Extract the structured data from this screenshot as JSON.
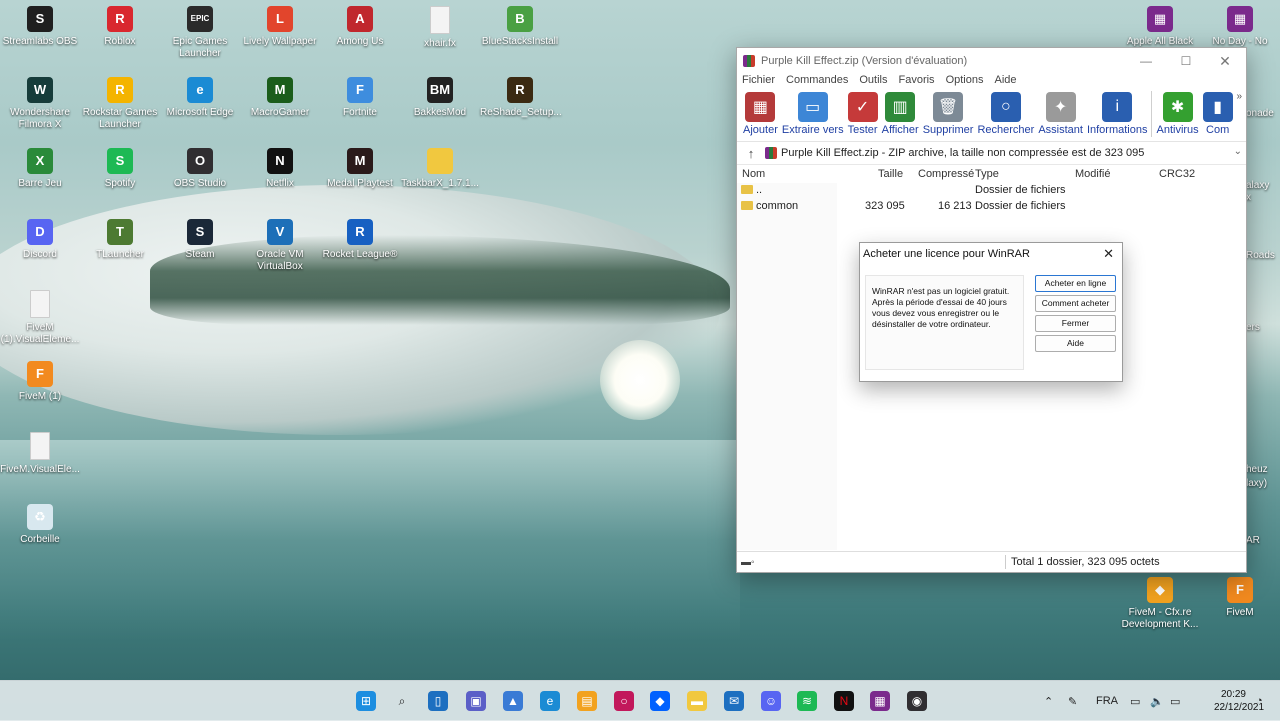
{
  "desktop": {
    "icons_left": [
      {
        "label": "Streamlabs OBS",
        "icon": "streamlabs-icon",
        "color": "#1f1f1f",
        "glyph": "S"
      },
      {
        "label": "Roblox",
        "icon": "roblox-icon",
        "color": "#d9272e",
        "glyph": "R"
      },
      {
        "label": "Epic Games Launcher",
        "icon": "epic-games-icon",
        "color": "#2a2a2a",
        "glyph": "EPIC"
      },
      {
        "label": "Lively Wallpaper",
        "icon": "lively-wallpaper-icon",
        "color": "#e2452c",
        "glyph": "L"
      },
      {
        "label": "Among Us",
        "icon": "among-us-icon",
        "color": "#c0272d",
        "glyph": "A"
      },
      {
        "label": "xhair.fx",
        "icon": "file-icon",
        "color": "#f4f4f4",
        "glyph": ""
      },
      {
        "label": "BlueStacksInstall",
        "icon": "bluestacks-icon",
        "color": "#4aa043",
        "glyph": "B"
      },
      {
        "label": "Wondershare Filmora X",
        "icon": "filmora-icon",
        "color": "#163c3a",
        "glyph": "W"
      },
      {
        "label": "Rockstar Games Launcher",
        "icon": "rockstar-icon",
        "color": "#f4b400",
        "glyph": "R"
      },
      {
        "label": "Microsoft Edge",
        "icon": "edge-icon",
        "color": "#1b8bd4",
        "glyph": "e"
      },
      {
        "label": "MacroGamer",
        "icon": "macrogamer-icon",
        "color": "#1b5d1b",
        "glyph": "M"
      },
      {
        "label": "Fortnite",
        "icon": "fortnite-icon",
        "color": "#3e8dde",
        "glyph": "F"
      },
      {
        "label": "BakkesMod",
        "icon": "bakkesmod-icon",
        "color": "#222",
        "glyph": "BM"
      },
      {
        "label": "ReShade_Setup...",
        "icon": "reshade-icon",
        "color": "#3b2a12",
        "glyph": "R"
      },
      {
        "label": "Barre Jeu",
        "icon": "game-bar-icon",
        "color": "#2a8a3a",
        "glyph": "X"
      },
      {
        "label": "Spotify",
        "icon": "spotify-icon",
        "color": "#1db954",
        "glyph": "S"
      },
      {
        "label": "OBS Studio",
        "icon": "obs-icon",
        "color": "#302e31",
        "glyph": "O"
      },
      {
        "label": "Netflix",
        "icon": "netflix-icon",
        "color": "#111",
        "glyph": "N"
      },
      {
        "label": "Medal Playtest",
        "icon": "medal-icon",
        "color": "#2a1a1a",
        "glyph": "M"
      },
      {
        "label": "TaskbarX_1.7.1...",
        "icon": "folder-icon",
        "color": "#f1c83f",
        "glyph": ""
      },
      {
        "label": "Discord",
        "icon": "discord-icon",
        "color": "#5865f2",
        "glyph": "D"
      },
      {
        "label": "TLauncher",
        "icon": "tlauncher-icon",
        "color": "#4d7a32",
        "glyph": "T"
      },
      {
        "label": "Steam",
        "icon": "steam-icon",
        "color": "#1b2838",
        "glyph": "S"
      },
      {
        "label": "Oracle VM VirtualBox",
        "icon": "virtualbox-icon",
        "color": "#1d6fb8",
        "glyph": "V"
      },
      {
        "label": "Rocket League®",
        "icon": "rocket-league-icon",
        "color": "#1760c2",
        "glyph": "R"
      },
      {
        "label": "FiveM (1).VisualEleme...",
        "icon": "file-icon",
        "color": "#f4f4f4",
        "glyph": ""
      },
      {
        "label": "FiveM (1)",
        "icon": "fivem-icon",
        "color": "#f28a1f",
        "glyph": "F"
      },
      {
        "label": "FiveM.VisualEle...",
        "icon": "file-icon",
        "color": "#f4f4f4",
        "glyph": ""
      },
      {
        "label": "Corbeille",
        "icon": "recycle-bin-icon",
        "color": "#d8e8ef",
        "glyph": "♻"
      }
    ],
    "icons_right": [
      {
        "label": "Apple All Black",
        "icon": "winrar-archive-icon",
        "color": "#7b2a8c",
        "glyph": "▦"
      },
      {
        "label": "No Day - No",
        "icon": "winrar-archive-icon",
        "color": "#7b2a8c",
        "glyph": "▦"
      },
      {
        "label": "FiveM - Cfx.re Development K...",
        "icon": "fivem-devkit-icon",
        "color": "#f2a21f",
        "glyph": "◆"
      },
      {
        "label": "FiveM",
        "icon": "fivem-icon",
        "color": "#f28a1f",
        "glyph": "F"
      }
    ],
    "right_edge_fragments": [
      "onade",
      "alaxy",
      "x",
      "Roads",
      "ers",
      "heuz",
      "laxy)",
      "AR"
    ]
  },
  "winrar": {
    "title": "Purple Kill Effect.zip (Version d'évaluation)",
    "menu": [
      "Fichier",
      "Commandes",
      "Outils",
      "Favoris",
      "Options",
      "Aide"
    ],
    "toolbar": [
      {
        "label": "Ajouter",
        "icon": "add-archive-icon",
        "color": "#b43a3a"
      },
      {
        "label": "Extraire vers",
        "icon": "extract-folder-icon",
        "color": "#3d86d6"
      },
      {
        "label": "Tester",
        "icon": "test-clipboard-icon",
        "color": "#c53a3a"
      },
      {
        "label": "Afficher",
        "icon": "view-book-icon",
        "color": "#2f8a3a"
      },
      {
        "label": "Supprimer",
        "icon": "delete-trash-icon",
        "color": "#7d8a96"
      },
      {
        "label": "Rechercher",
        "icon": "find-magnifier-icon",
        "color": "#2a5fb0"
      },
      {
        "label": "Assistant",
        "icon": "wizard-wand-icon",
        "color": "#9a9a9a"
      },
      {
        "label": "Informations",
        "icon": "info-icon",
        "color": "#2a5fb0"
      },
      {
        "label": "Antivirus",
        "icon": "antivirus-bug-icon",
        "color": "#34a030"
      },
      {
        "label": "Com",
        "icon": "comment-icon",
        "color": "#2a5fb0"
      }
    ],
    "path_text": "Purple Kill Effect.zip - ZIP archive, la taille non compressée est de 323 095",
    "columns": {
      "name": "Nom",
      "size": "Taille",
      "packed": "Compressé",
      "type": "Type",
      "modified": "Modifié",
      "crc": "CRC32"
    },
    "rows": [
      {
        "name": "..",
        "size": "",
        "packed": "",
        "type": "Dossier de fichiers"
      },
      {
        "name": "common",
        "size": "323 095",
        "packed": "16 213",
        "type": "Dossier de fichiers"
      }
    ],
    "status": "Total 1 dossier, 323 095 octets"
  },
  "dialog": {
    "title": "Acheter une licence pour WinRAR",
    "message": "WinRAR n'est pas un logiciel gratuit.\nAprès la période d'essai de 40 jours\nvous devez vous enregistrer ou le\ndésinstaller de votre ordinateur.",
    "buttons": [
      "Acheter en ligne",
      "Comment acheter",
      "Fermer",
      "Aide"
    ]
  },
  "taskbar": {
    "apps": [
      {
        "icon": "windows-start-icon",
        "color": "#1d8ee0"
      },
      {
        "icon": "search-icon",
        "color": "#333"
      },
      {
        "icon": "task-view-icon",
        "color": "#1d6fc0"
      },
      {
        "icon": "teams-chat-icon",
        "color": "#5b5fc7"
      },
      {
        "icon": "photos-icon",
        "color": "#3a7bd5"
      },
      {
        "icon": "edge-icon",
        "color": "#1b8bd4"
      },
      {
        "icon": "store-icon",
        "color": "#f2a21f"
      },
      {
        "icon": "medal-ring-icon",
        "color": "#c2185b"
      },
      {
        "icon": "dropbox-icon",
        "color": "#0061fe"
      },
      {
        "icon": "file-explorer-icon",
        "color": "#f1c83f"
      },
      {
        "icon": "mail-icon",
        "color": "#1d6fc0"
      },
      {
        "icon": "discord-icon",
        "color": "#5865f2"
      },
      {
        "icon": "spotify-icon",
        "color": "#1db954"
      },
      {
        "icon": "netflix-icon",
        "color": "#111"
      },
      {
        "icon": "winrar-icon",
        "color": "#7b2a8c"
      },
      {
        "icon": "obs-icon",
        "color": "#302e31"
      }
    ],
    "language": "FRA",
    "time": "20:29",
    "date": "22/12/2021"
  }
}
